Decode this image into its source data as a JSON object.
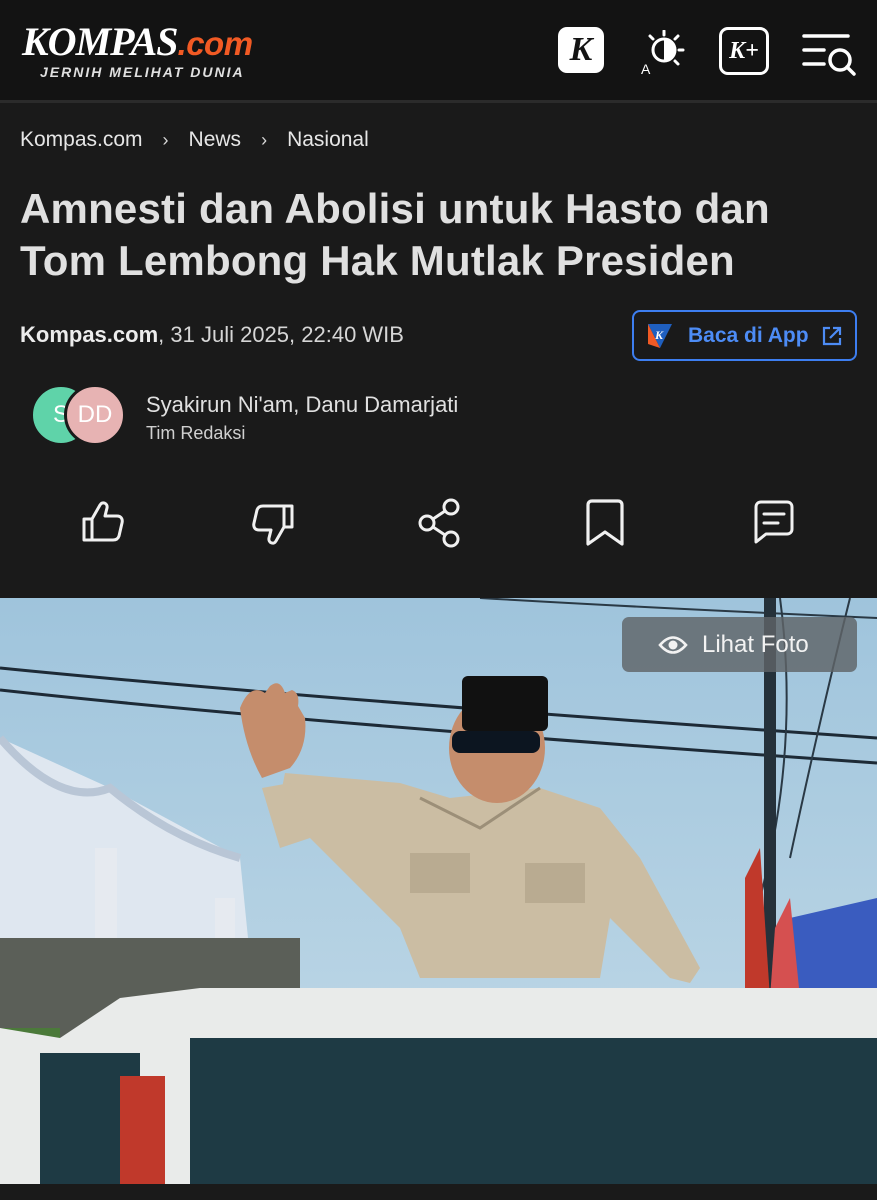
{
  "header": {
    "logo_main": "KOMPAS",
    "logo_suffix": ".com",
    "logo_tagline": "JERNIH MELIHAT DUNIA",
    "icons": [
      "kompas-k-icon",
      "contrast-icon",
      "kompas-plus-icon",
      "menu-search-icon"
    ],
    "k_label": "K",
    "kplus_label": "K+"
  },
  "breadcrumb": [
    "Kompas.com",
    "News",
    "Nasional"
  ],
  "article": {
    "title_line1": "Amnesti dan Abolisi untuk Hasto dan",
    "title_line2": "Tom Lembong Hak Mutlak Presiden",
    "source": "Kompas.com",
    "date": ", 31 Juli 2025, 22:40 WIB",
    "app_button": "Baca di App",
    "authors": "Syakirun Ni'am,  Danu Damarjati",
    "team": "Tim Redaksi",
    "avatar_1": "S",
    "avatar_2": "DD"
  },
  "actions": [
    "like-icon",
    "dislike-icon",
    "share-icon",
    "bookmark-icon",
    "comment-icon"
  ],
  "photo": {
    "button_label": "Lihat Foto"
  },
  "colors": {
    "background": "#1a1a1a",
    "header": "#131313",
    "accent_orange": "#f15a24",
    "link_blue": "#4d8cf5"
  }
}
